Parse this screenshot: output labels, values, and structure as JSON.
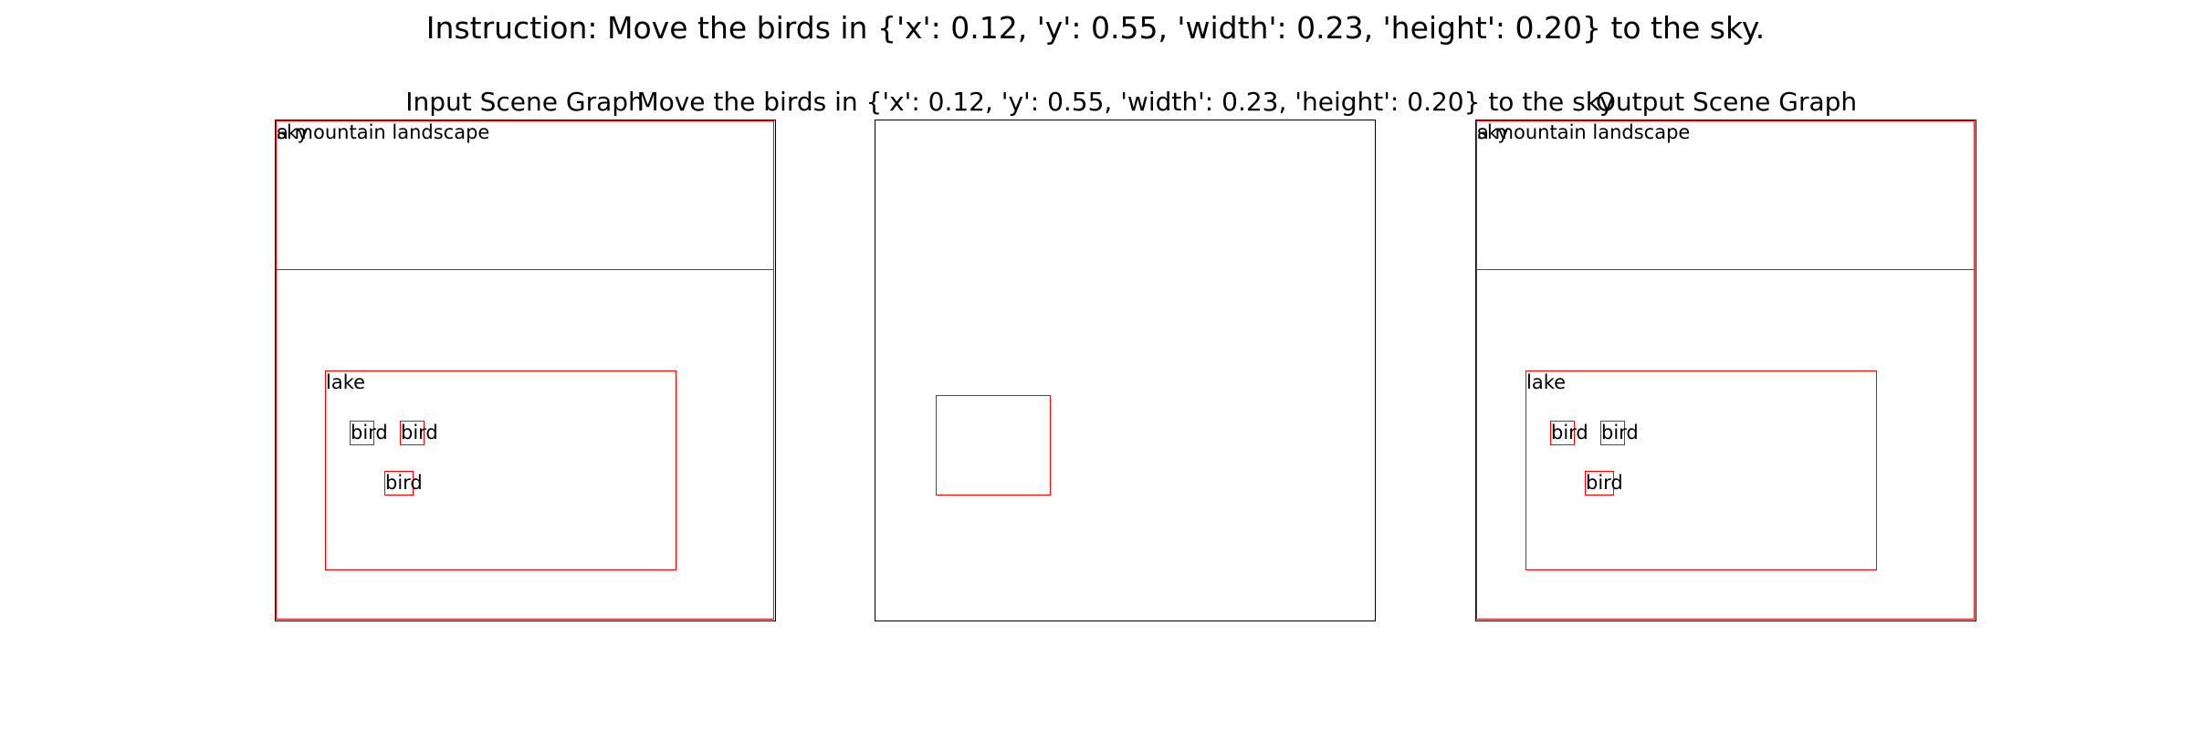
{
  "instruction": "Instruction: Move the birds in {'x': 0.12, 'y': 0.55, 'width': 0.23, 'height': 0.20} to the sky.",
  "panels": {
    "input": {
      "title": "Input Scene Graph",
      "image_label": "a mountain landscape",
      "objects": [
        "sky",
        "lake",
        "bird",
        "bird",
        "bird"
      ]
    },
    "mask": {
      "title": "Move the birds in {'x': 0.12, 'y': 0.55, 'width': 0.23, 'height': 0.20} to the sky"
    },
    "output": {
      "title": "Output Scene Graph",
      "image_label": "a mountain landscape",
      "objects": [
        "sky",
        "lake",
        "bird",
        "bird",
        "bird"
      ]
    }
  },
  "colors": {
    "box": "#ff0000",
    "panel_border": "#000000"
  }
}
